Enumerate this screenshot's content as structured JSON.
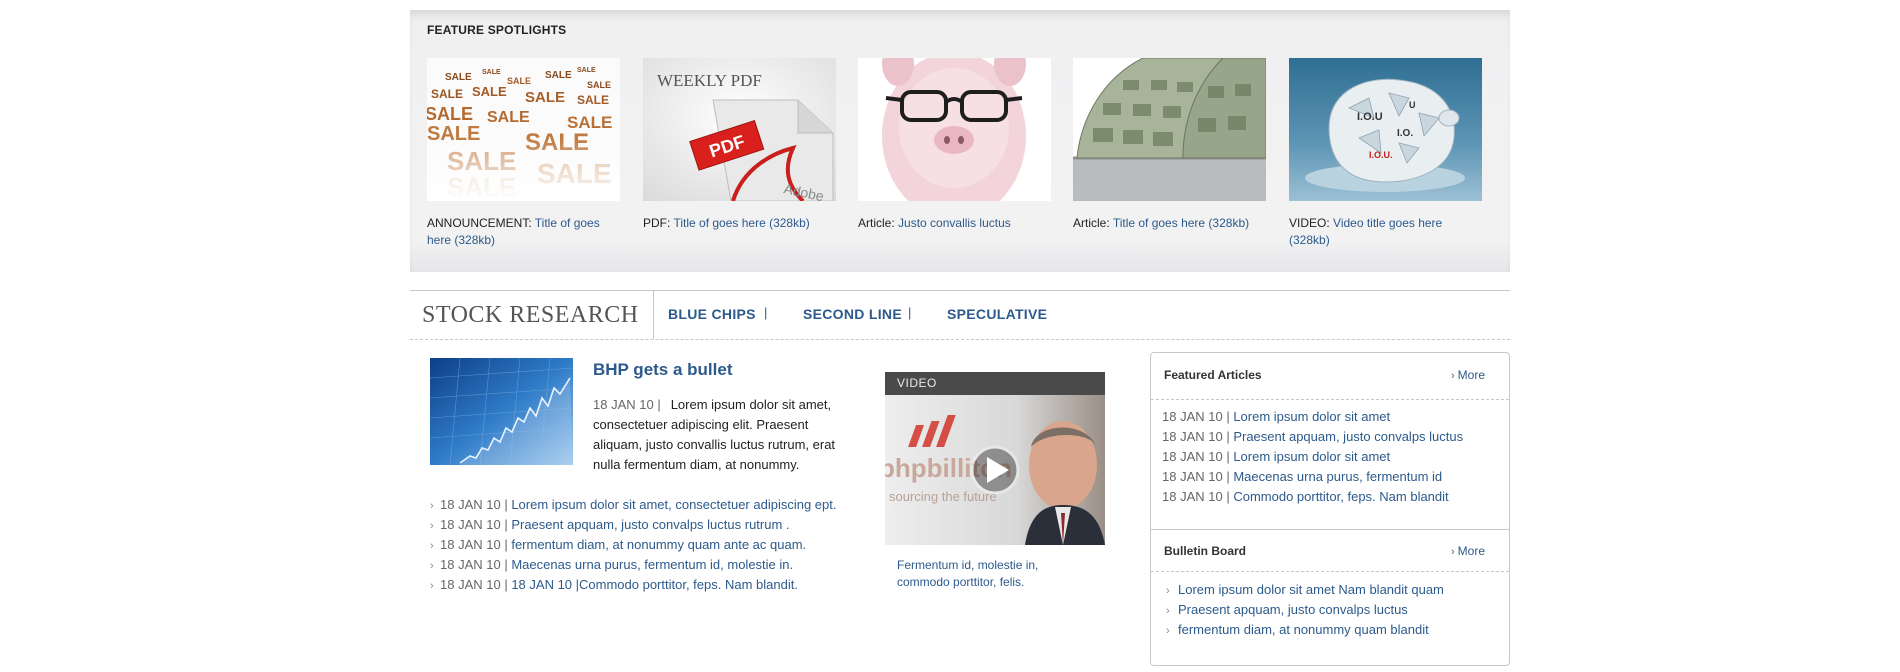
{
  "spotlights": {
    "title": "FEATURE SPOTLIGHTS",
    "items": [
      {
        "prefix": "ANNOUNCEMENT:",
        "link": "Title of goes here (328kb)",
        "image": "sale-image"
      },
      {
        "prefix": "PDF:",
        "link": "Title of goes here (328kb)",
        "image": "weekly-pdf-image",
        "image_text": "WEEKLY PDF",
        "badge": "PDF"
      },
      {
        "prefix": "Article:",
        "link": "Justo convallis luctus",
        "image": "piggy-bank-image"
      },
      {
        "prefix": "Article:",
        "link": "Title of goes here (328kb)",
        "image": "dollar-bills-image"
      },
      {
        "prefix": "VIDEO:",
        "link": "Video title goes here (328kb)",
        "image": "shattered-piggy-image"
      }
    ]
  },
  "research": {
    "title": "STOCK RESEARCH",
    "tabs": [
      "BLUE CHIPS",
      "SECOND LINE",
      "SPECULATIVE"
    ],
    "separator": "|"
  },
  "story": {
    "title": "BHP gets a bullet",
    "date": "18 JAN 10 |",
    "body": "Lorem ipsum dolor sit amet, consectetuer adipiscing elit. Praesent aliquam, justo convallis luctus rutrum, erat nulla fermentum diam, at nonummy.",
    "list": [
      {
        "date": "18 JAN 10 |",
        "text": "Lorem ipsum dolor sit amet, consectetuer adipiscing ept."
      },
      {
        "date": "18 JAN 10 |",
        "text": "Praesent apquam, justo convalps luctus rutrum ."
      },
      {
        "date": "18 JAN 10 |",
        "text": "fermentum diam, at nonummy quam ante ac quam."
      },
      {
        "date": "18 JAN 10 |",
        "text": "Maecenas urna purus, fermentum id, molestie in."
      },
      {
        "date": "18 JAN 10 |",
        "text": "18 JAN 10 |Commodo porttitor, feps. Nam blandit."
      }
    ]
  },
  "video": {
    "label": "VIDEO",
    "caption": "Fermentum id, molestie in, commodo porttitor, felis.",
    "frame_text": "bhpbilliton",
    "frame_tagline": "sourcing the future"
  },
  "featured": {
    "title": "Featured Articles",
    "more": "More",
    "items": [
      {
        "date": "18 JAN 10 |",
        "text": "Lorem ipsum dolor sit amet"
      },
      {
        "date": "18 JAN 10 |",
        "text": "Praesent apquam, justo convalps luctus"
      },
      {
        "date": "18 JAN 10 |",
        "text": "Lorem ipsum dolor sit amet"
      },
      {
        "date": "18 JAN 10 |",
        "text": "Maecenas urna purus, fermentum id"
      },
      {
        "date": "18 JAN 10 |",
        "text": "Commodo porttitor, feps. Nam blandit"
      }
    ]
  },
  "bulletin": {
    "title": "Bulletin Board",
    "more": "More",
    "items": [
      "Lorem ipsum dolor sit amet Nam blandit quam",
      "Praesent apquam, justo convalps luctus",
      "fermentum diam, at nonummy quam blandit"
    ]
  },
  "colors": {
    "link": "#2d5a8c",
    "video_bar": "#4a4a4a",
    "panel": "#f0f0f1"
  },
  "icons": {
    "bullet": "chevron-right-icon",
    "video": "play-icon"
  }
}
